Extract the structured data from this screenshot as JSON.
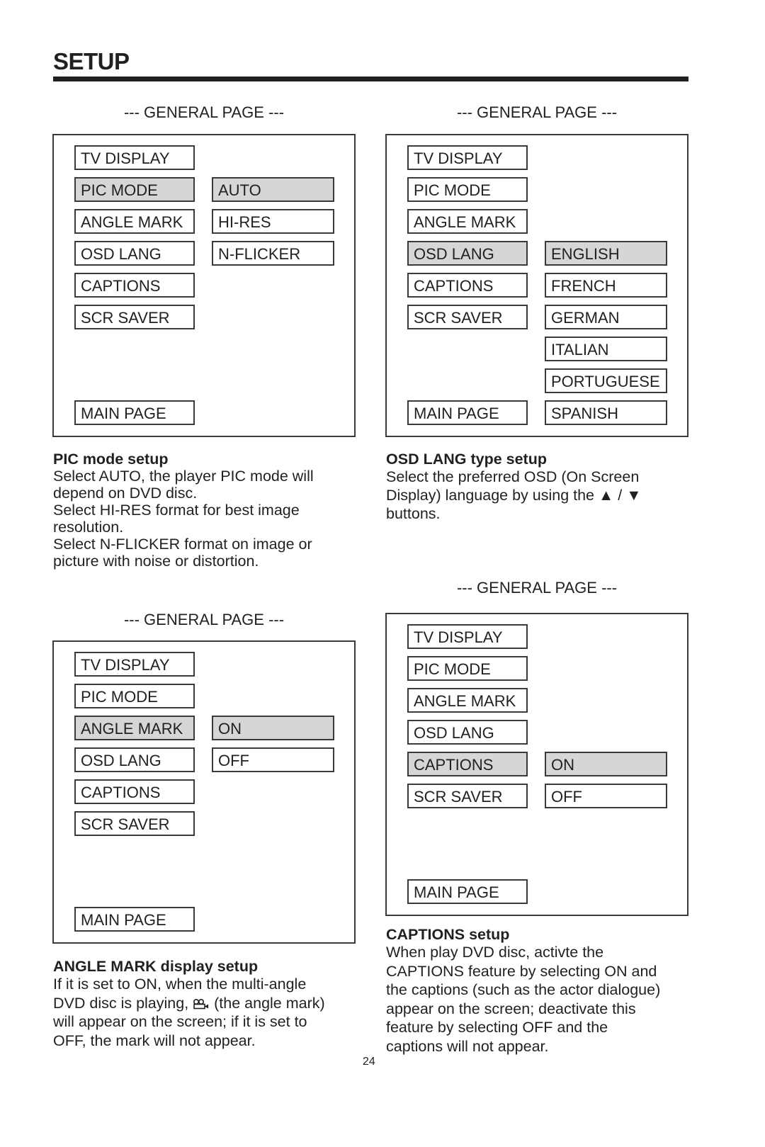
{
  "page": {
    "title": "SETUP",
    "page_number": "24",
    "highlight_color": "#d6d6d6"
  },
  "panels": [
    {
      "caption": "--- GENERAL PAGE ---",
      "menu": [
        "TV DISPLAY",
        "PIC MODE",
        "ANGLE MARK",
        "OSD LANG",
        "CAPTIONS",
        "SCR SAVER",
        "MAIN PAGE"
      ],
      "selected_menu": "PIC MODE",
      "options": [
        "AUTO",
        "HI-RES",
        "N-FLICKER"
      ],
      "selected_option": "AUTO"
    },
    {
      "caption": "--- GENERAL PAGE ---",
      "menu": [
        "TV DISPLAY",
        "PIC MODE",
        "ANGLE MARK",
        "OSD LANG",
        "CAPTIONS",
        "SCR SAVER",
        "MAIN PAGE"
      ],
      "selected_menu": "OSD LANG",
      "options": [
        "ENGLISH",
        "FRENCH",
        "GERMAN",
        "ITALIAN",
        "PORTUGUESE",
        "SPANISH"
      ],
      "selected_option": "ENGLISH"
    },
    {
      "caption": "--- GENERAL PAGE ---",
      "menu": [
        "TV DISPLAY",
        "PIC MODE",
        "ANGLE MARK",
        "OSD LANG",
        "CAPTIONS",
        "SCR SAVER",
        "MAIN PAGE"
      ],
      "selected_menu": "ANGLE MARK",
      "options": [
        "ON",
        "OFF"
      ],
      "selected_option": "ON"
    },
    {
      "caption": "--- GENERAL PAGE ---",
      "menu": [
        "TV DISPLAY",
        "PIC MODE",
        "ANGLE MARK",
        "OSD LANG",
        "CAPTIONS",
        "SCR SAVER",
        "MAIN PAGE"
      ],
      "selected_menu": "CAPTIONS",
      "options": [
        "ON",
        "OFF"
      ],
      "selected_option": "ON"
    }
  ],
  "sections": {
    "pic_mode": {
      "heading": "PIC mode setup",
      "lines": [
        "Select AUTO, the player PIC mode will",
        "depend on DVD disc.",
        "Select HI-RES format for best image",
        "resolution.",
        "Select N-FLICKER format on image or",
        "picture with noise or distortion."
      ]
    },
    "osd_lang": {
      "heading": "OSD LANG type setup",
      "lines": [
        "Select the preferred OSD (On Screen",
        "Display) language by using the ▲ / ▼",
        "buttons."
      ]
    },
    "angle_mark": {
      "heading": "ANGLE MARK display setup",
      "line1": "If it is set to ON, when the multi-angle",
      "line2_before": "DVD disc is playing, ",
      "line2_after": " (the angle mark)",
      "line3": "will appear on the screen; if it is set to",
      "line4": "OFF, the mark will not appear.",
      "icon": "angle-mark-icon"
    },
    "captions": {
      "heading": "CAPTIONS setup",
      "lines": [
        "When play DVD disc, activte the",
        "CAPTIONS feature by selecting ON and",
        "the captions (such as the actor dialogue)",
        "appear on the screen; deactivate this",
        "feature by selecting OFF and the",
        "captions will not appear."
      ]
    }
  }
}
